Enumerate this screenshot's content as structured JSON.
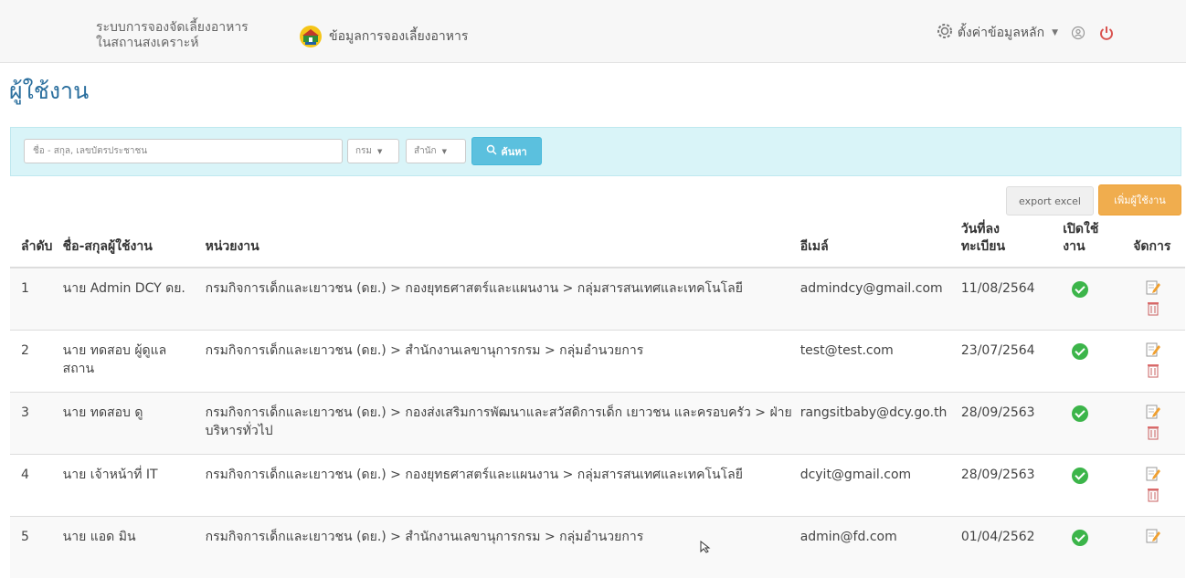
{
  "nav": {
    "brand_line1": "ระบบการจองจัดเลี้ยงอาหาร",
    "brand_line2": "ในสถานสงเคราะห์",
    "menu_booking": "ข้อมูลการจองเลี้ยงอาหาร",
    "settings_label": "ตั้งค่าข้อมูลหลัก",
    "icons": [
      "home-logo-icon",
      "gear-icon",
      "user-icon",
      "power-icon"
    ],
    "power_color": "#d9534f"
  },
  "page": {
    "title": "ผู้ใช้งาน"
  },
  "search": {
    "placeholder": "ชื่อ - สกุล, เลขบัตรประชาชน",
    "ministry_label": "กรม",
    "office_label": "สำนัก",
    "button_label": "ค้นหา"
  },
  "actions": {
    "export_label": "export excel",
    "add_label": "เพิ่มผู้ใช้งาน"
  },
  "table": {
    "headers": {
      "no": "ลำดับ",
      "name": "ชื่อ-สกุลผู้ใช้งาน",
      "unit": "หน่วยงาน",
      "email": "อีเมล์",
      "date_line1": "วันที่ลง",
      "date_line2": "ทะเบียน",
      "active_line1": "เปิดใช้",
      "active_line2": "งาน",
      "manage": "จัดการ"
    },
    "rows": [
      {
        "no": "1",
        "name": "นาย Admin DCY ดย.",
        "unit": "กรมกิจการเด็กและเยาวชน (ดย.) > กองยุทธศาสตร์และแผนงาน > กลุ่มสารสนเทศและเทคโนโลยี",
        "email": "admindcy@gmail.com",
        "date": "11/08/2564"
      },
      {
        "no": "2",
        "name": "นาย ทดสอบ ผู้ดูแลสถาน",
        "unit": "กรมกิจการเด็กและเยาวชน (ดย.) > สำนักงานเลขานุการกรม > กลุ่มอำนวยการ",
        "email": "test@test.com",
        "date": "23/07/2564"
      },
      {
        "no": "3",
        "name": "นาย ทดสอบ ดู",
        "unit": "กรมกิจการเด็กและเยาวชน (ดย.) > กองส่งเสริมการพัฒนาและสวัสดิการเด็ก เยาวชน และครอบครัว > ฝ่ายบริหารทั่วไป",
        "email": "rangsitbaby@dcy.go.th",
        "date": "28/09/2563"
      },
      {
        "no": "4",
        "name": "นาย เจ้าหน้าที่ IT",
        "unit": "กรมกิจการเด็กและเยาวชน (ดย.) > กองยุทธศาสตร์และแผนงาน > กลุ่มสารสนเทศและเทคโนโลยี",
        "email": "dcyit@gmail.com",
        "date": "28/09/2563"
      },
      {
        "no": "5",
        "name": "นาย แอด มิน",
        "unit": "กรมกิจการเด็กและเยาวชน (ดย.) > สำนักงานเลขานุการกรม > กลุ่มอำนวยการ",
        "email": "admin@fd.com",
        "date": "01/04/2562"
      }
    ]
  },
  "colors": {
    "title_blue": "#2b6f9e",
    "search_bg": "#d9f4f8",
    "search_btn": "#5bc0de",
    "add_btn": "#f0ad4e",
    "check_green": "#3cb54a"
  }
}
